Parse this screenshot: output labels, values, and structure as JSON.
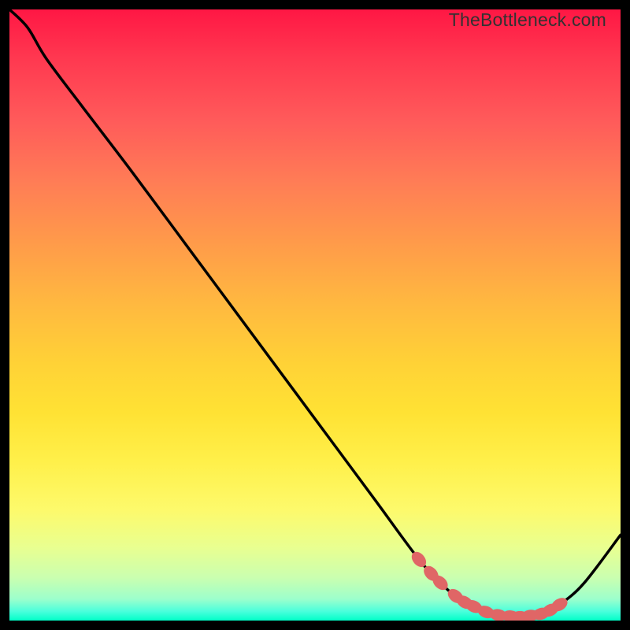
{
  "watermark": "TheBottleneck.com",
  "chart_data": {
    "type": "line",
    "title": "",
    "xlabel": "",
    "ylabel": "",
    "xlim": [
      0,
      100
    ],
    "ylim": [
      0,
      100
    ],
    "grid": false,
    "series": [
      {
        "name": "curve",
        "x": [
          0,
          3,
          6,
          12,
          20,
          30,
          40,
          50,
          60,
          64,
          67,
          69,
          71,
          73,
          76,
          78,
          80,
          82,
          83,
          84,
          85,
          87,
          90,
          94,
          100
        ],
        "y": [
          100,
          97,
          92,
          84,
          73.5,
          60,
          46.5,
          33,
          19.5,
          14,
          10,
          7.7,
          5.7,
          4,
          2.3,
          1.4,
          0.9,
          0.7,
          0.6,
          0.6,
          0.7,
          1.1,
          2.6,
          6.1,
          14
        ]
      }
    ],
    "markers": {
      "name": "highlight-dots",
      "color": "#e06666",
      "points": [
        {
          "x": 67,
          "y": 10
        },
        {
          "x": 69,
          "y": 7.7
        },
        {
          "x": 70.5,
          "y": 6.2
        },
        {
          "x": 73,
          "y": 4
        },
        {
          "x": 74.5,
          "y": 3
        },
        {
          "x": 76,
          "y": 2.3
        },
        {
          "x": 78,
          "y": 1.4
        },
        {
          "x": 80,
          "y": 0.9
        },
        {
          "x": 82,
          "y": 0.7
        },
        {
          "x": 83.5,
          "y": 0.6
        },
        {
          "x": 85.2,
          "y": 0.8
        },
        {
          "x": 87,
          "y": 1.1
        },
        {
          "x": 88.5,
          "y": 1.7
        },
        {
          "x": 90,
          "y": 2.6
        }
      ]
    },
    "gradient_stops": [
      {
        "pos": 0,
        "color": "#ff1744"
      },
      {
        "pos": 8,
        "color": "#ff3850"
      },
      {
        "pos": 18,
        "color": "#ff5a5a"
      },
      {
        "pos": 28,
        "color": "#ff7c56"
      },
      {
        "pos": 38,
        "color": "#ff9a4a"
      },
      {
        "pos": 48,
        "color": "#ffb840"
      },
      {
        "pos": 58,
        "color": "#ffd236"
      },
      {
        "pos": 66,
        "color": "#ffe234"
      },
      {
        "pos": 74,
        "color": "#fff04a"
      },
      {
        "pos": 82,
        "color": "#fdfa6c"
      },
      {
        "pos": 88,
        "color": "#e9ff90"
      },
      {
        "pos": 93,
        "color": "#caffb0"
      },
      {
        "pos": 96.5,
        "color": "#9cffcc"
      },
      {
        "pos": 98.5,
        "color": "#4affdc"
      },
      {
        "pos": 100,
        "color": "#00ffc8"
      }
    ]
  }
}
